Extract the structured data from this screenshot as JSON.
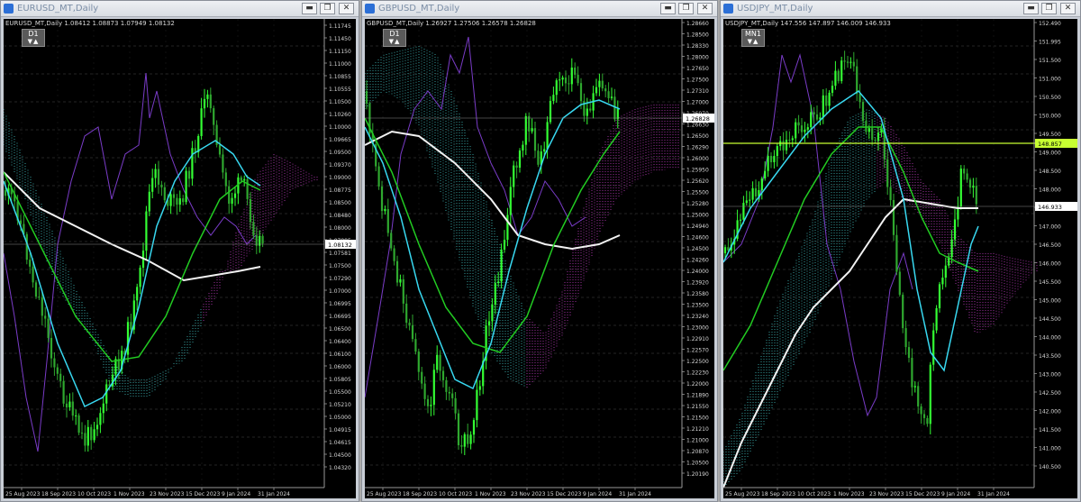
{
  "windows": [
    {
      "symbol": "EURUSD",
      "title": "EURUSD_MT,Daily",
      "ohlc": "EURUSD_MT,Daily  1.08412 1.08873 1.07949 1.08132",
      "timeframe": "D1",
      "current_price": "1.08132",
      "price_labels": [
        "1.11745",
        "1.11450",
        "1.11150",
        "1.11000",
        "1.10855",
        "1.10555",
        "1.10500",
        "1.10260",
        "1.10000",
        "1.09665",
        "1.09500",
        "1.09370",
        "1.09000",
        "1.08775",
        "1.08500",
        "1.08480",
        "1.08000",
        "1.07885",
        "1.07581",
        "1.07500",
        "1.07290",
        "1.07000",
        "1.06995",
        "1.06695",
        "1.06500",
        "1.06400",
        "1.06100",
        "1.06000",
        "1.05805",
        "1.05500",
        "1.05210",
        "1.05000",
        "1.04915",
        "1.04615",
        "1.04500",
        "1.04320"
      ],
      "date_labels": [
        "25 Aug 2023",
        "18 Sep 2023",
        "10 Oct 2023",
        "1 Nov 2023",
        "23 Nov 2023",
        "15 Dec 2023",
        "9 Jan 2024",
        "31 Jan 2024"
      ]
    },
    {
      "symbol": "GBPUSD",
      "title": "GBPUSD_MT,Daily",
      "ohlc": "GBPUSD_MT,Daily  1.26927 1.27506 1.26578 1.26828",
      "timeframe": "D1",
      "current_price": "1.26828",
      "price_labels": [
        "1.28660",
        "1.28500",
        "1.28330",
        "1.28000",
        "1.27650",
        "1.27500",
        "1.27310",
        "1.27000",
        "1.26970",
        "1.26630",
        "1.26500",
        "1.26290",
        "1.26000",
        "1.25950",
        "1.25620",
        "1.25500",
        "1.25280",
        "1.25000",
        "1.24940",
        "1.24600",
        "1.24500",
        "1.24260",
        "1.24000",
        "1.23920",
        "1.23580",
        "1.23500",
        "1.23240",
        "1.23000",
        "1.22910",
        "1.22570",
        "1.22500",
        "1.22230",
        "1.22000",
        "1.21890",
        "1.21550",
        "1.21500",
        "1.21210",
        "1.21000",
        "1.20870",
        "1.20500",
        "1.20190"
      ],
      "date_labels": [
        "25 Aug 2023",
        "18 Sep 2023",
        "10 Oct 2023",
        "1 Nov 2023",
        "23 Nov 2023",
        "15 Dec 2023",
        "9 Jan 2024",
        "31 Jan 2024"
      ]
    },
    {
      "symbol": "USDJPY",
      "title": "USDJPY_MT,Daily",
      "ohlc": "USDJPY_MT,Daily  147.556 147.897 146.009 146.933",
      "timeframe": "MN1",
      "current_price": "146.933",
      "hline_price": "148.857",
      "price_labels": [
        "152.490",
        "151.995",
        "151.500",
        "151.000",
        "150.500",
        "150.000",
        "149.500",
        "149.000",
        "148.500",
        "148.000",
        "147.500",
        "147.000",
        "146.500",
        "146.000",
        "145.500",
        "145.000",
        "144.500",
        "144.000",
        "143.500",
        "143.000",
        "142.500",
        "142.000",
        "141.500",
        "141.000",
        "140.500",
        "140.000"
      ],
      "date_labels": [
        "25 Aug 2023",
        "18 Sep 2023",
        "10 Oct 2023",
        "1 Nov 2023",
        "23 Nov 2023",
        "15 Dec 2023",
        "9 Jan 2024",
        "31 Jan 2024"
      ]
    }
  ],
  "window_buttons": {
    "minimize": "▬",
    "restore": "❐",
    "close": "✕"
  },
  "colors": {
    "bull": "#33ff33",
    "bear": "#2fa82f",
    "ma_fast": "#38d8f0",
    "ma_mid": "#22cc22",
    "ma_slow": "#f2f2f2",
    "chikou": "#7a3cc8",
    "kumo_bull": "#46d0d0",
    "kumo_bear": "#d13fd1",
    "hline": "#c8ff32",
    "grid": "#4a4a4a"
  },
  "icons": {
    "window": "chart-window-icon",
    "arrows": "▼▲"
  }
}
